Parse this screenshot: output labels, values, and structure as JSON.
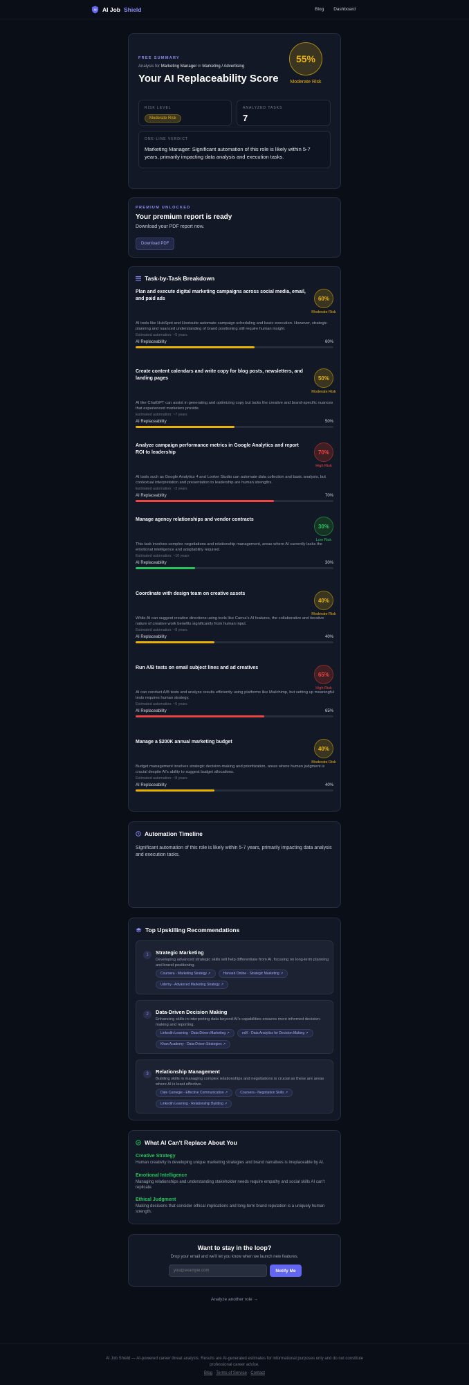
{
  "nav": {
    "brand_prefix": "AI Job",
    "brand_highlight": "Shield",
    "links": [
      "Blog",
      "Dashboard"
    ]
  },
  "summary": {
    "eyebrow": "FREE SUMMARY",
    "analysis_prefix": "Analysis for",
    "role": "Marketing Manager",
    "in_word": "in",
    "industry": "Marketing / Advertising",
    "title": "Your AI Replaceability Score",
    "score": "55%",
    "score_label": "Moderate Risk",
    "risk_level_label": "RISK LEVEL",
    "risk_level_value": "Moderate Risk",
    "analyzed_tasks_label": "ANALYZED TASKS",
    "analyzed_tasks_value": "7",
    "verdict_label": "ONE-LINE VERDICT",
    "verdict": "Marketing Manager: Significant automation of this role is likely within 5-7 years, primarily impacting data analysis and execution tasks."
  },
  "premium": {
    "eyebrow": "PREMIUM UNLOCKED",
    "title": "Your premium report is ready",
    "subtitle": "Download your PDF report now.",
    "button": "Download PDF"
  },
  "tasks_section": {
    "title": "Task-by-Task Breakdown",
    "bar_label": "AI Replaceability",
    "tasks": [
      {
        "title": "Plan and execute digital marketing campaigns across social media, email, and paid ads",
        "score": "60%",
        "pct": 60,
        "risk": "Moderate Risk",
        "level": "moderate",
        "desc": "AI tools like HubSpot and Hootsuite automate campaign scheduling and basic execution. However, strategic planning and nuanced understanding of brand positioning still require human insight.",
        "est": "Estimated automation: ~5 years",
        "bar_value": "60%"
      },
      {
        "title": "Create content calendars and write copy for blog posts, newsletters, and landing pages",
        "score": "50%",
        "pct": 50,
        "risk": "Moderate Risk",
        "level": "moderate",
        "desc": "AI like ChatGPT can assist in generating and optimizing copy but lacks the creative and brand-specific nuances that experienced marketers provide.",
        "est": "Estimated automation: ~7 years",
        "bar_value": "50%"
      },
      {
        "title": "Analyze campaign performance metrics in Google Analytics and report ROI to leadership",
        "score": "70%",
        "pct": 70,
        "risk": "High Risk",
        "level": "high",
        "desc": "AI tools such as Google Analytics 4 and Looker Studio can automate data collection and basic analysis, but contextual interpretation and presentation to leadership are human strengths.",
        "est": "Estimated automation: ~3 years",
        "bar_value": "70%"
      },
      {
        "title": "Manage agency relationships and vendor contracts",
        "score": "30%",
        "pct": 30,
        "risk": "Low Risk",
        "level": "low",
        "desc": "This task involves complex negotiations and relationship management, areas where AI currently lacks the emotional intelligence and adaptability required.",
        "est": "Estimated automation: ~10 years",
        "bar_value": "30%"
      },
      {
        "title": "Coordinate with design team on creative assets",
        "score": "40%",
        "pct": 40,
        "risk": "Moderate Risk",
        "level": "moderate",
        "desc": "While AI can suggest creative directions using tools like Canva's AI features, the collaborative and iterative nature of creative work benefits significantly from human input.",
        "est": "Estimated automation: ~8 years",
        "bar_value": "40%"
      },
      {
        "title": "Run A/B tests on email subject lines and ad creatives",
        "score": "65%",
        "pct": 65,
        "risk": "High Risk",
        "level": "high",
        "desc": "AI can conduct A/B tests and analyze results efficiently using platforms like Mailchimp, but setting up meaningful tests requires human strategy.",
        "est": "Estimated automation: ~6 years",
        "bar_value": "65%"
      },
      {
        "title": "Manage a $200K annual marketing budget",
        "score": "40%",
        "pct": 40,
        "risk": "Moderate Risk",
        "level": "moderate",
        "desc": "Budget management involves strategic decision-making and prioritization, areas where human judgment is crucial despite AI's ability to suggest budget allocations.",
        "est": "Estimated automation: ~8 years",
        "bar_value": "40%"
      }
    ]
  },
  "timeline": {
    "title": "Automation Timeline",
    "text": "Significant automation of this role is likely within 5-7 years, primarily impacting data analysis and execution tasks."
  },
  "upskilling": {
    "title": "Top Upskilling Recommendations",
    "items": [
      {
        "num": "1",
        "title": "Strategic Marketing",
        "desc": "Developing advanced strategic skills will help differentiate from AI, focusing on long-term planning and brand positioning.",
        "tags": [
          "Coursera - Marketing Strategy ↗",
          "Harvard Online - Strategic Marketing ↗",
          "Udemy - Advanced Marketing Strategy ↗"
        ]
      },
      {
        "num": "2",
        "title": "Data-Driven Decision Making",
        "desc": "Enhancing skills in interpreting data beyond AI's capabilities ensures more informed decision-making and reporting.",
        "tags": [
          "LinkedIn Learning - Data-Driven Marketing ↗",
          "edX - Data Analytics for Decision Making ↗",
          "Khan Academy - Data-Driven Strategies ↗"
        ]
      },
      {
        "num": "3",
        "title": "Relationship Management",
        "desc": "Building skills in managing complex relationships and negotiations is crucial as these are areas where AI is least effective.",
        "tags": [
          "Dale Carnegie - Effective Communication ↗",
          "Coursera - Negotiation Skills ↗",
          "LinkedIn Learning - Relationship Building ↗"
        ]
      }
    ]
  },
  "irreplaceable": {
    "title": "What AI Can't Replace About You",
    "items": [
      {
        "title": "Creative Strategy",
        "desc": "Human creativity in developing unique marketing strategies and brand narratives is irreplaceable by AI."
      },
      {
        "title": "Emotional Intelligence",
        "desc": "Managing relationships and understanding stakeholder needs require empathy and social skills AI can't replicate."
      },
      {
        "title": "Ethical Judgment",
        "desc": "Making decisions that consider ethical implications and long-term brand reputation is a uniquely human strength."
      }
    ]
  },
  "newsletter": {
    "title": "Want to stay in the loop?",
    "subtitle": "Drop your email and we'll let you know when we launch new features.",
    "placeholder": "you@example.com",
    "button": "Notify Me"
  },
  "analyze_another": "Analyze another role →",
  "footer": {
    "text": "AI Job Shield — AI-powered career threat analysis. Results are AI-generated estimates for informational purposes only and do not constitute professional career advice.",
    "links": [
      "Blog",
      "Terms of Service",
      "Contact"
    ],
    "sep": "·"
  },
  "colors": {
    "moderate": "#eab308",
    "high": "#ef4444",
    "low": "#22c55e",
    "accent": "#6366f1"
  }
}
